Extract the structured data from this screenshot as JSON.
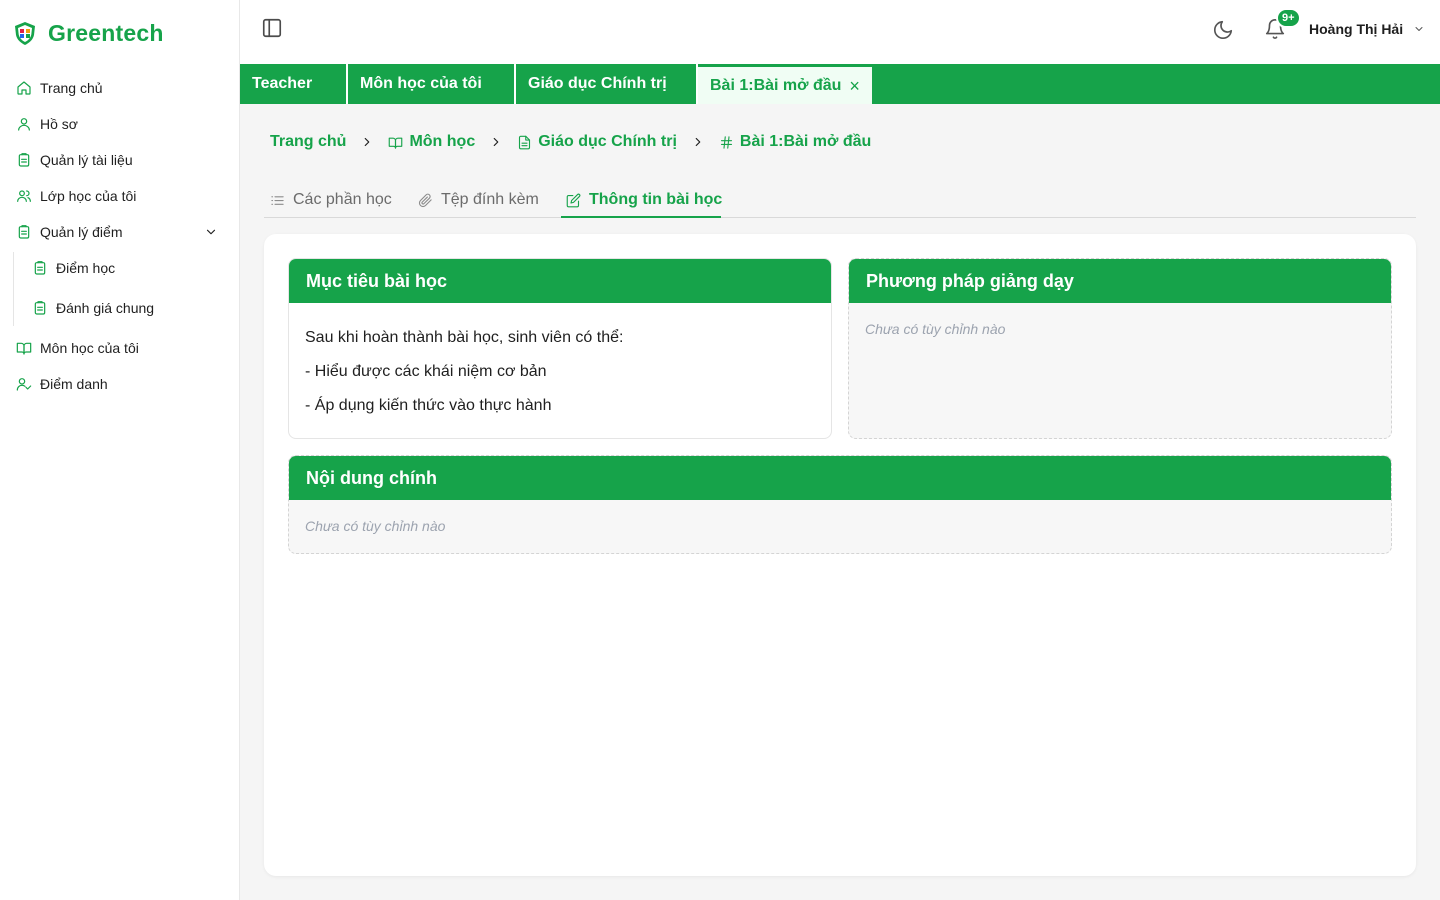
{
  "brand": {
    "name": "Greentech"
  },
  "sidebar": {
    "items": [
      {
        "label": "Trang chủ",
        "icon": "home-icon"
      },
      {
        "label": "Hồ sơ",
        "icon": "user-icon"
      },
      {
        "label": "Quản lý tài liệu",
        "icon": "document-icon"
      },
      {
        "label": "Lớp học của tôi",
        "icon": "users-icon"
      },
      {
        "label": "Quản lý điểm",
        "icon": "clipboard-icon"
      },
      {
        "label": "Điểm học",
        "icon": "clipboard-icon"
      },
      {
        "label": "Đánh giá chung",
        "icon": "clipboard-icon"
      },
      {
        "label": "Môn học của tôi",
        "icon": "book-open-icon"
      },
      {
        "label": "Điểm danh",
        "icon": "user-check-icon"
      }
    ]
  },
  "header": {
    "notification_badge": "9+",
    "user_name": "Hoàng Thị Hải"
  },
  "tabs": [
    {
      "label": "Teacher"
    },
    {
      "label": "Môn học của tôi"
    },
    {
      "label": "Giáo dục Chính trị"
    },
    {
      "label": "Bài 1:Bài mở đầu",
      "active": true,
      "close": "×"
    }
  ],
  "breadcrumb": [
    {
      "label": "Trang chủ"
    },
    {
      "label": "Môn học",
      "icon": "book-open-icon"
    },
    {
      "label": "Giáo dục Chính trị",
      "icon": "file-icon"
    },
    {
      "label": "Bài 1:Bài mở đầu",
      "icon": "hash-icon"
    }
  ],
  "content_tabs": [
    {
      "label": "Các phần học",
      "icon": "list-icon"
    },
    {
      "label": "Tệp đính kèm",
      "icon": "paperclip-icon"
    },
    {
      "label": "Thông tin bài học",
      "icon": "edit-icon",
      "active": true
    }
  ],
  "cards": {
    "objectives": {
      "title": "Mục tiêu bài học",
      "lines": [
        "Sau khi hoàn thành bài học, sinh viên có thể:",
        "- Hiểu được các khái niệm cơ bản",
        "- Áp dụng kiến thức vào thực hành"
      ]
    },
    "methods": {
      "title": "Phương pháp giảng dạy",
      "empty": "Chưa có tùy chỉnh nào"
    },
    "content": {
      "title": "Nội dung chính",
      "empty": "Chưa có tùy chỉnh nào"
    }
  },
  "colors": {
    "accent": "#16a34a",
    "active_tab_bg": "#f0fdf4"
  }
}
